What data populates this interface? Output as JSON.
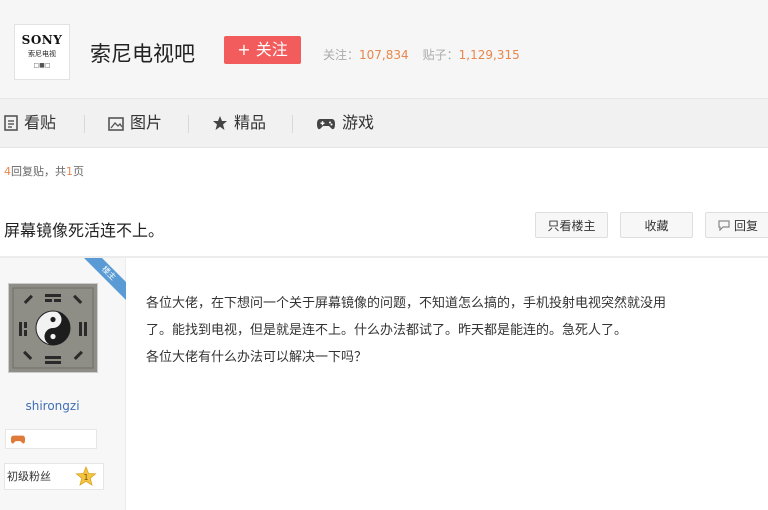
{
  "forum": {
    "logo_brand": "SONY",
    "logo_sub": "索尼电视",
    "logo_mini": "□■□",
    "name": "索尼电视吧",
    "follow_label": "+ 关注",
    "followers_label": "关注：",
    "followers_value": "107,834",
    "posts_label": "贴子：",
    "posts_value": "1,129,315"
  },
  "nav": {
    "items": [
      {
        "label": "看贴",
        "icon": "document-icon"
      },
      {
        "label": "图片",
        "icon": "image-icon"
      },
      {
        "label": "精品",
        "icon": "star-icon"
      },
      {
        "label": "游戏",
        "icon": "gamepad-icon"
      }
    ]
  },
  "thread": {
    "reply_count": "4",
    "reply_text": "回复贴，共",
    "page_count": "1",
    "page_suffix": "页",
    "title": "屏幕镜像死活连不上。",
    "buttons": {
      "only_op": "只看楼主",
      "collect": "收藏",
      "reply": "回复"
    }
  },
  "post": {
    "ribbon": "楼主",
    "author": "shirongzi",
    "level_name": "初级粉丝",
    "level_num": "1",
    "lines": [
      "各位大佬，在下想问一个关于屏幕镜像的问题，不知道怎么搞的，手机投射电视突然就没用",
      "了。能找到电视，但是就是连不上。什么办法都试了。昨天都是能连的。急死人了。",
      "各位大佬有什么办法可以解决一下吗？"
    ]
  },
  "colors": {
    "accent": "#f25c5c",
    "stat_number": "#e8864b",
    "username": "#3f6fb5",
    "ribbon": "#5b9bd5"
  }
}
